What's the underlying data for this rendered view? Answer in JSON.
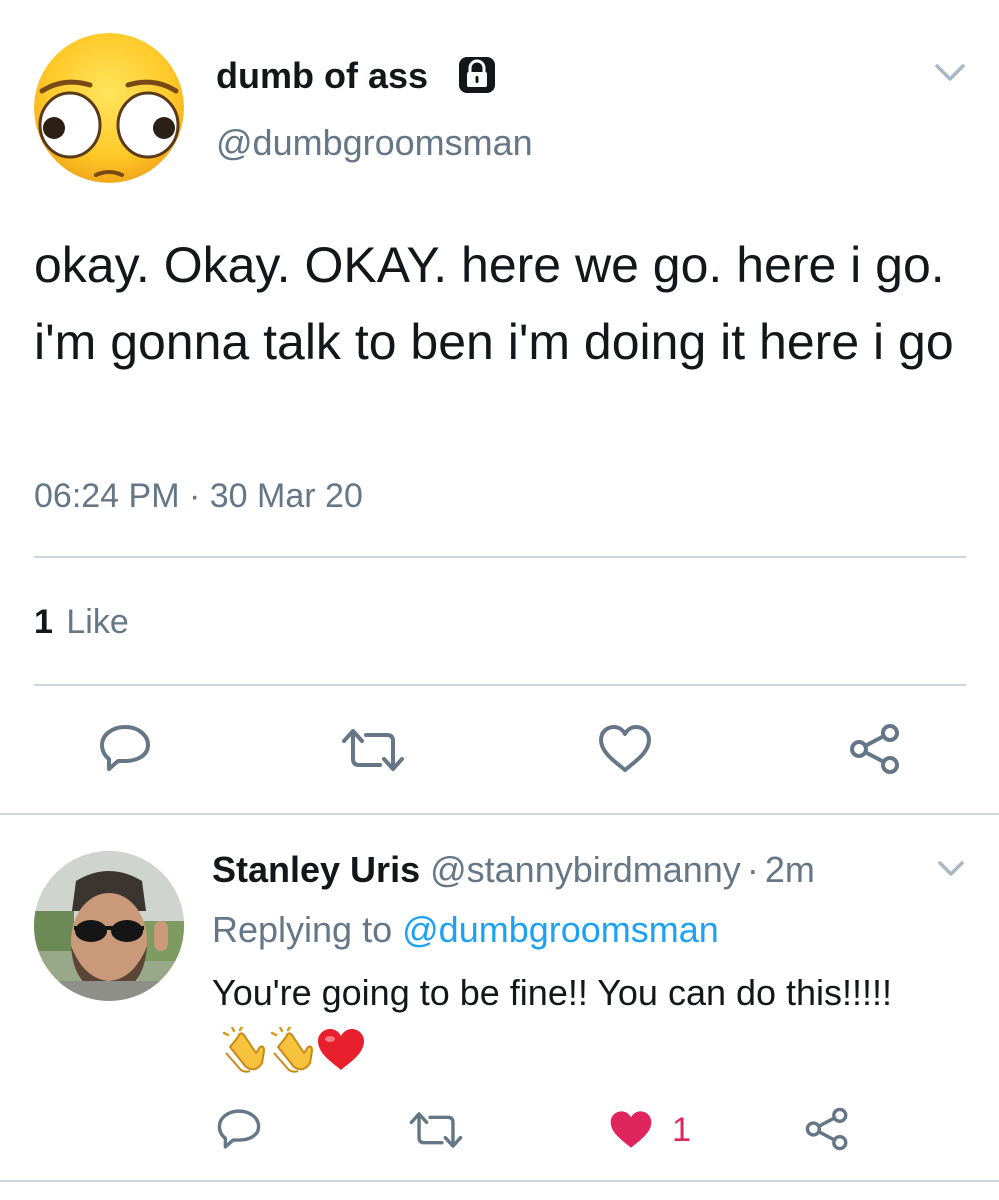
{
  "main_tweet": {
    "display_name": "dumb of ass",
    "handle": "@dumbgroomsman",
    "text": "okay. Okay. OKAY. here we go. here i go. i'm gonna talk to ben i'm doing it here i go",
    "time": "06:24 PM",
    "date_separator": "·",
    "date": "30 Mar 20",
    "likes_count": "1",
    "likes_label": "Like"
  },
  "reply": {
    "display_name": "Stanley Uris",
    "handle": "@stannybirdmanny",
    "separator": "·",
    "age": "2m",
    "replying_prefix": "Replying to",
    "replying_handle": "@dumbgroomsman",
    "text": "You're going to be fine!! You can do this!!!!!",
    "like_count": "1"
  },
  "colors": {
    "muted": "#657786",
    "link": "#1da1f2",
    "liked": "#e0245e",
    "divider": "#cfd6dc"
  },
  "icons": {
    "lock": "lock-icon",
    "chevron": "chevron-down-icon",
    "reply": "reply-icon",
    "retweet": "retweet-icon",
    "like": "heart-icon",
    "share": "share-icon",
    "clap": "clapping-hands-emoji",
    "heart_emoji": "red-heart-emoji"
  }
}
